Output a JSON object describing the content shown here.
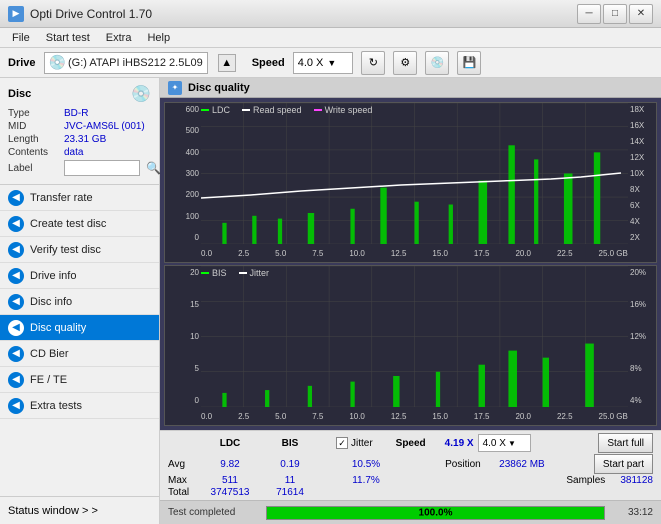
{
  "app": {
    "title": "Opti Drive Control 1.70",
    "icon": "▶"
  },
  "title_controls": {
    "minimize": "─",
    "maximize": "□",
    "close": "✕"
  },
  "menu": {
    "items": [
      "File",
      "Start test",
      "Extra",
      "Help"
    ]
  },
  "drive_bar": {
    "label": "Drive",
    "drive_text": "(G:)  ATAPI iHBS212  2.5L09",
    "speed_label": "Speed",
    "speed_value": "4.0 X"
  },
  "disc": {
    "label": "Disc",
    "type_key": "Type",
    "type_val": "BD-R",
    "mid_key": "MID",
    "mid_val": "JVC-AMS6L (001)",
    "length_key": "Length",
    "length_val": "23.31 GB",
    "contents_key": "Contents",
    "contents_val": "data",
    "label_key": "Label",
    "label_placeholder": ""
  },
  "nav": {
    "items": [
      {
        "id": "transfer-rate",
        "label": "Transfer rate",
        "active": false
      },
      {
        "id": "create-test-disc",
        "label": "Create test disc",
        "active": false
      },
      {
        "id": "verify-test-disc",
        "label": "Verify test disc",
        "active": false
      },
      {
        "id": "drive-info",
        "label": "Drive info",
        "active": false
      },
      {
        "id": "disc-info",
        "label": "Disc info",
        "active": false
      },
      {
        "id": "disc-quality",
        "label": "Disc quality",
        "active": true
      },
      {
        "id": "cd-bier",
        "label": "CD Bier",
        "active": false
      },
      {
        "id": "fe-te",
        "label": "FE / TE",
        "active": false
      },
      {
        "id": "extra-tests",
        "label": "Extra tests",
        "active": false
      }
    ]
  },
  "status_window": {
    "label": "Status window  > >"
  },
  "disc_quality": {
    "title": "Disc quality",
    "legend1": [
      {
        "label": "LDC",
        "color": "#00ff00"
      },
      {
        "label": "Read speed",
        "color": "#ffffff"
      },
      {
        "label": "Write speed",
        "color": "#ff44ff"
      }
    ],
    "legend2": [
      {
        "label": "BIS",
        "color": "#00ff00"
      },
      {
        "label": "Jitter",
        "color": "#ffffff"
      }
    ],
    "chart1": {
      "y_labels": [
        "600",
        "500",
        "400",
        "300",
        "200",
        "100",
        "0"
      ],
      "y_labels_right": [
        "18X",
        "16X",
        "14X",
        "12X",
        "10X",
        "8X",
        "6X",
        "4X",
        "2X"
      ],
      "x_labels": [
        "0.0",
        "2.5",
        "5.0",
        "7.5",
        "10.0",
        "12.5",
        "15.0",
        "17.5",
        "20.0",
        "22.5",
        "25.0 GB"
      ]
    },
    "chart2": {
      "y_labels": [
        "20",
        "15",
        "10",
        "5",
        "0"
      ],
      "y_labels_right": [
        "20%",
        "16%",
        "12%",
        "8%",
        "4%"
      ],
      "x_labels": [
        "0.0",
        "2.5",
        "5.0",
        "7.5",
        "10.0",
        "12.5",
        "15.0",
        "17.5",
        "20.0",
        "22.5",
        "25.0 GB"
      ]
    }
  },
  "stats": {
    "headers": [
      "",
      "LDC",
      "BIS",
      "",
      "Jitter",
      "Speed",
      ""
    ],
    "avg_label": "Avg",
    "avg_ldc": "9.82",
    "avg_bis": "0.19",
    "avg_jitter": "10.5%",
    "avg_speed_val": "4.19 X",
    "avg_speed_select": "4.0 X",
    "max_label": "Max",
    "max_ldc": "511",
    "max_bis": "11",
    "max_jitter": "11.7%",
    "position_label": "Position",
    "position_val": "23862 MB",
    "total_label": "Total",
    "total_ldc": "3747513",
    "total_bis": "71614",
    "samples_label": "Samples",
    "samples_val": "381128",
    "jitter_checked": true,
    "start_full_label": "Start full",
    "start_part_label": "Start part"
  },
  "progress": {
    "status_text": "Test completed",
    "percent": 100,
    "percent_display": "100.0%",
    "time": "33:12"
  }
}
